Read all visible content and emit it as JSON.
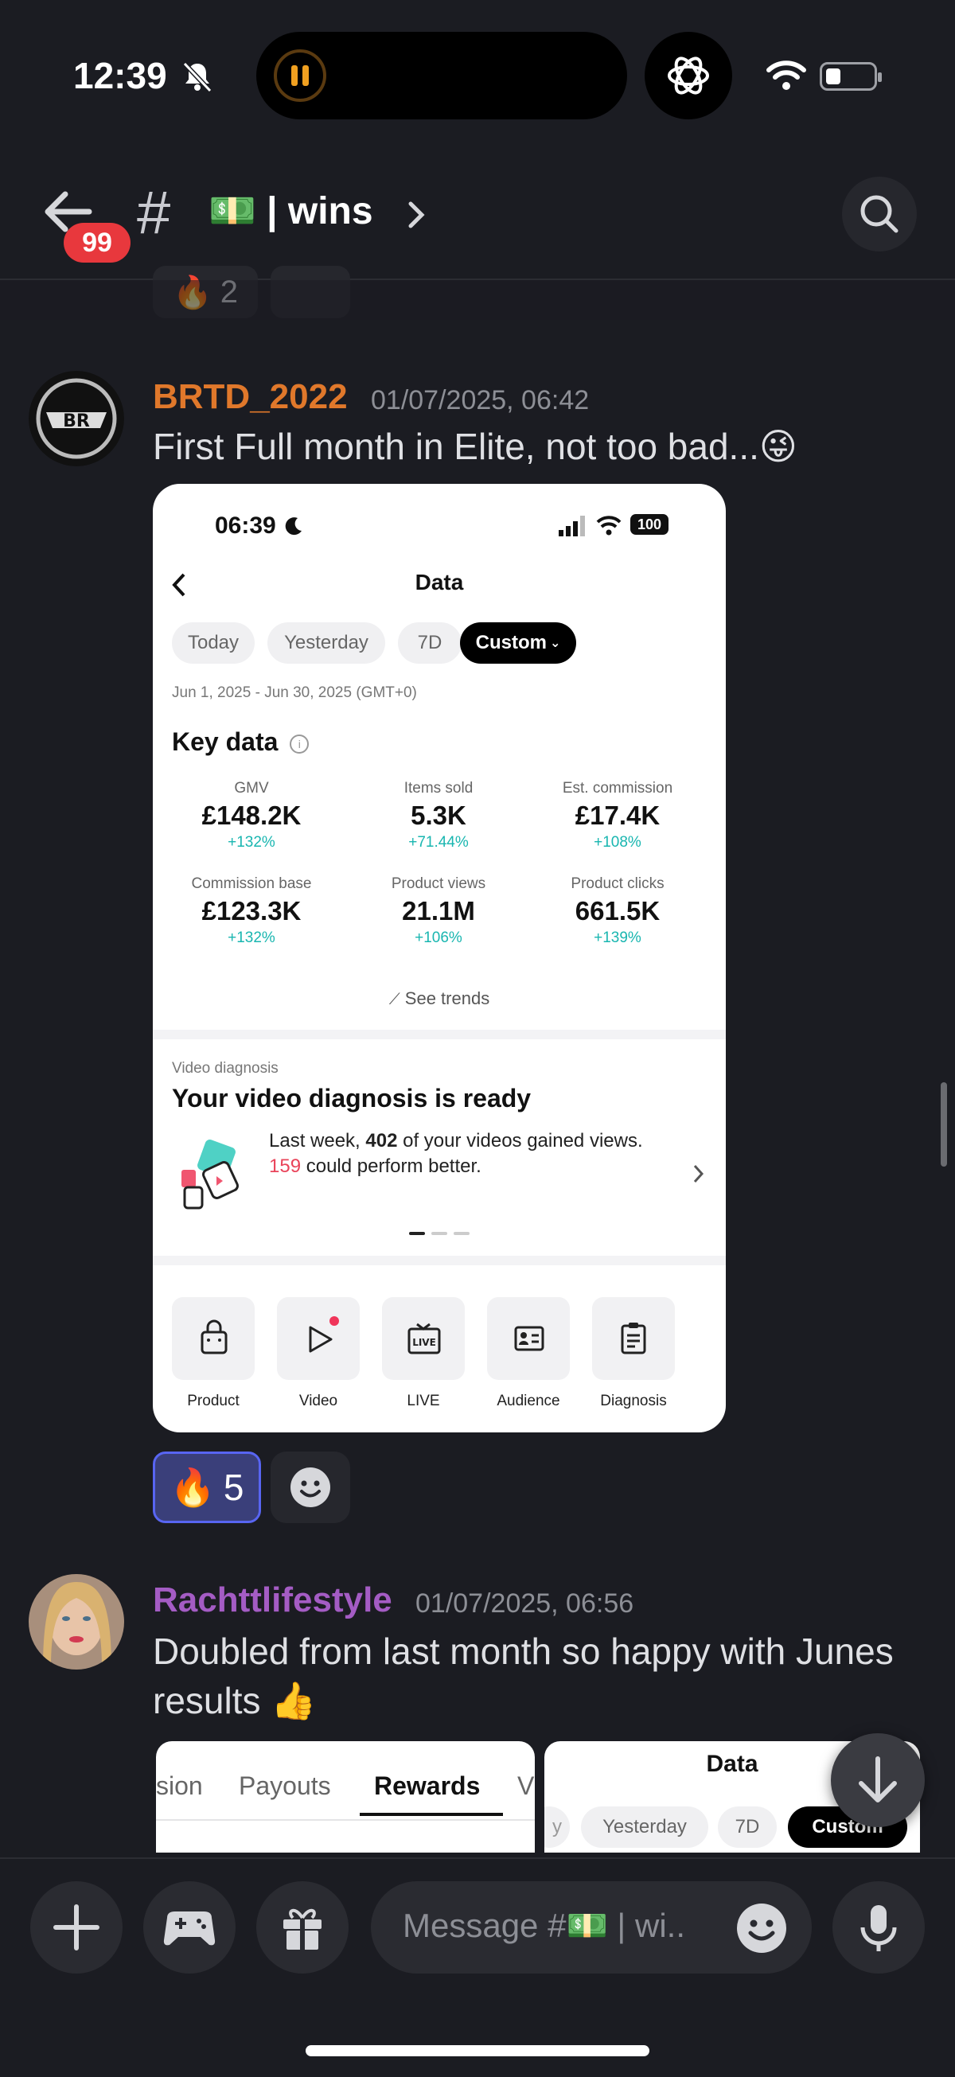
{
  "status_bar": {
    "time": "12:39"
  },
  "header": {
    "unread_badge": "99",
    "hash": "#",
    "channel_emoji": "💵",
    "channel_name": "| wins"
  },
  "top_reaction": {
    "emoji": "🔥",
    "count": "2"
  },
  "messages": [
    {
      "username": "BRTD_2022",
      "username_color": "#e0782b",
      "timestamp": "01/07/2025, 06:42",
      "text": "First Full month in Elite, not too bad...😜",
      "reaction": {
        "emoji": "🔥",
        "count": "5"
      }
    },
    {
      "username": "Rachttlifestyle",
      "username_color": "#a45cc4",
      "timestamp": "01/07/2025, 06:56",
      "text_line1": "Doubled from last month so happy with Junes",
      "text_line2": "results 👍"
    }
  ],
  "embedded_screenshot": {
    "time": "06:39",
    "battery": "100",
    "title": "Data",
    "filters": [
      "Today",
      "Yesterday",
      "7D",
      "Custom"
    ],
    "date_range": "Jun 1, 2025 - Jun 30, 2025 (GMT+0)",
    "key_data_title": "Key data",
    "metrics": [
      {
        "label": "GMV",
        "value": "£148.2K",
        "delta": "+132%"
      },
      {
        "label": "Items sold",
        "value": "5.3K",
        "delta": "+71.44%"
      },
      {
        "label": "Est. commission",
        "value": "£17.4K",
        "delta": "+108%"
      },
      {
        "label": "Commission base",
        "value": "£123.3K",
        "delta": "+132%"
      },
      {
        "label": "Product views",
        "value": "21.1M",
        "delta": "+106%"
      },
      {
        "label": "Product clicks",
        "value": "661.5K",
        "delta": "+139%"
      }
    ],
    "see_trends": "See trends",
    "video_diag_label": "Video diagnosis",
    "video_diag_title": "Your video diagnosis is ready",
    "video_diag_pre": "Last week, ",
    "video_diag_count": "402",
    "video_diag_mid": " of your videos gained views.",
    "video_diag_red": "159",
    "video_diag_post": " could perform better.",
    "tiles": [
      "Product",
      "Video",
      "LIVE",
      "Audience",
      "Diagnosis"
    ],
    "live_icon_text": "LIVE"
  },
  "second_images": {
    "left_tabs": [
      "sion",
      "Payouts",
      "Rewards",
      "V"
    ],
    "right_title": "Data",
    "right_filters": [
      "y",
      "Yesterday",
      "7D",
      "Custom"
    ]
  },
  "composer": {
    "placeholder": "Message #💵 | wi.."
  },
  "colors": {
    "accent": "#5865f2",
    "badge": "#e8383d",
    "teal": "#19b6b0",
    "background": "#1b1c22"
  }
}
